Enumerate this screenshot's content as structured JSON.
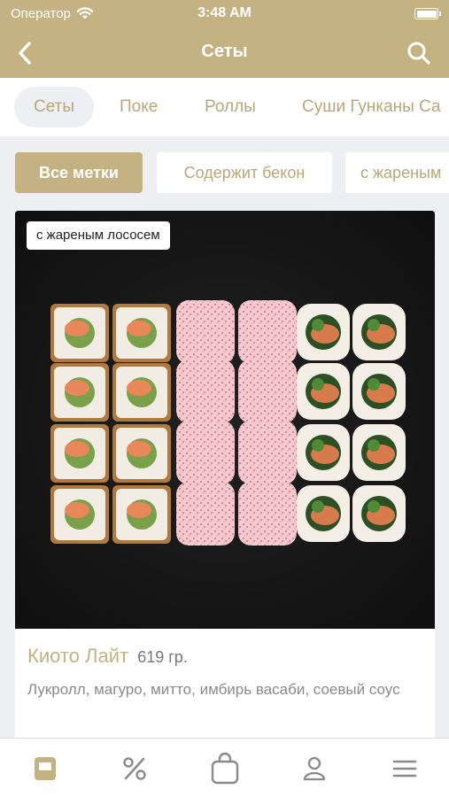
{
  "status_bar": {
    "carrier": "Оператор",
    "time": "3:48 AM"
  },
  "nav": {
    "title": "Сеты",
    "back_icon": "chevron-left-icon",
    "search_icon": "search-icon"
  },
  "categories": [
    {
      "label": "Сеты",
      "active": true
    },
    {
      "label": "Поке",
      "active": false
    },
    {
      "label": "Роллы",
      "active": false
    },
    {
      "label": "Суши Гунканы Са",
      "active": false
    }
  ],
  "tags": [
    {
      "label": "Все метки",
      "active": true
    },
    {
      "label": "Содержит бекон",
      "active": false
    },
    {
      "label": "с жареным",
      "active": false
    }
  ],
  "product": {
    "badge": "с жареным лососем",
    "name": "Киото Лайт",
    "weight": "619 гр.",
    "description": "Лукролл, магуро, митто, имбирь васаби, соевый соус"
  },
  "tabbar": {
    "items": [
      {
        "icon": "menu-book-icon",
        "active": true
      },
      {
        "icon": "percent-icon",
        "active": false
      },
      {
        "icon": "bag-icon",
        "active": false
      },
      {
        "icon": "profile-icon",
        "active": false
      },
      {
        "icon": "hamburger-icon",
        "active": false
      }
    ]
  },
  "colors": {
    "accent": "#c4b283",
    "background": "#eeeff2"
  }
}
